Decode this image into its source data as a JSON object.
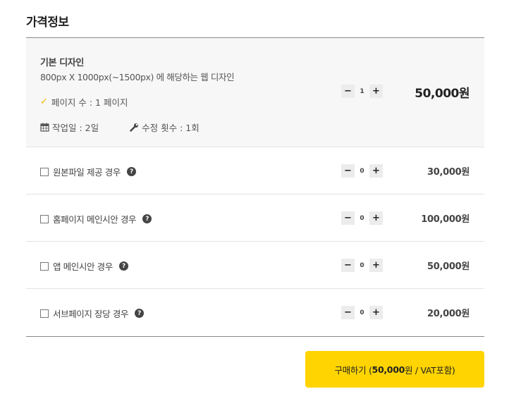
{
  "page": {
    "title": "가격정보"
  },
  "base": {
    "name": "기본 디자인",
    "desc": "800px X 1000px(~1500px) 에 해당하는 웹 디자인",
    "pages_label": "페이지 수 : 1 페이지",
    "workdays_label": "작업일 : 2일",
    "revisions_label": "수정 횟수 : 1회",
    "qty": "1",
    "price": "50,000원"
  },
  "options": [
    {
      "label": "원본파일 제공 경우",
      "qty": "0",
      "price": "30,000원"
    },
    {
      "label": "홈페이지 메인시안 경우",
      "qty": "0",
      "price": "100,000원"
    },
    {
      "label": "앱 메인시안 경우",
      "qty": "0",
      "price": "50,000원"
    },
    {
      "label": "서브페이지 장당 경우",
      "qty": "0",
      "price": "20,000원"
    }
  ],
  "stepper": {
    "minus": "−",
    "plus": "+"
  },
  "buy": {
    "prefix": "구매하기 (",
    "amount": "50,000",
    "suffix": "원 / VAT포함)"
  },
  "icons": {
    "check": "check-icon",
    "calendar": "calendar-icon",
    "wrench": "wrench-icon",
    "help": "question-circle-icon",
    "checkbox": "checkbox-icon"
  },
  "colors": {
    "accent": "#ffd400",
    "check": "#f0b400"
  }
}
